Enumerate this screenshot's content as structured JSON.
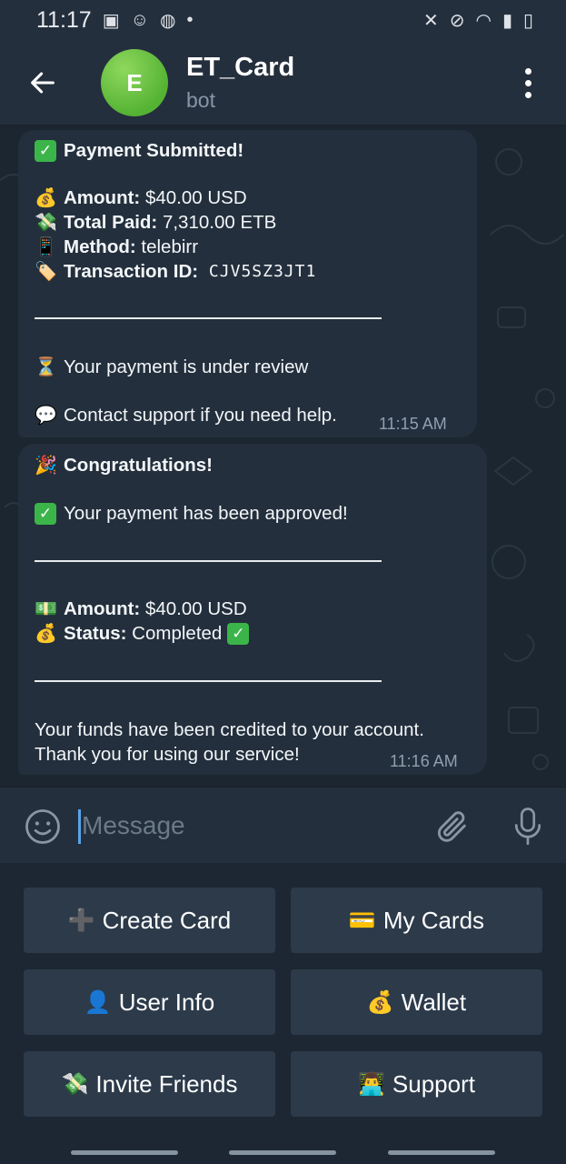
{
  "status_bar": {
    "time": "11:17"
  },
  "header": {
    "avatar_letter": "E",
    "title": "ET_Card",
    "subtitle": "bot"
  },
  "messages": [
    {
      "lines": [
        {
          "emoji": "✅",
          "bold": "Payment Submitted!",
          "text": ""
        },
        {
          "emoji": "💰",
          "bold": "Amount:",
          "text": " $40.00 USD"
        },
        {
          "emoji": "💸",
          "bold": "Total Paid:",
          "text": " 7,310.00 ETB"
        },
        {
          "emoji": "📱",
          "bold": "Method:",
          "text": " telebirr"
        },
        {
          "emoji": "🏷️",
          "bold": "Transaction ID:",
          "text": " CJV5SZ3JT1"
        },
        {
          "emoji": "⏳",
          "bold": "",
          "text": "Your payment is under review"
        },
        {
          "emoji": "💬",
          "bold": "",
          "text": "Contact support if you need help."
        }
      ],
      "time": "11:15 AM"
    },
    {
      "lines": [
        {
          "emoji": "🎉",
          "bold": "Congratulations!",
          "text": ""
        },
        {
          "emoji": "✅",
          "bold": "",
          "text": "Your payment has been approved!"
        },
        {
          "emoji": "💵",
          "bold": "Amount:",
          "text": " $40.00 USD"
        },
        {
          "emoji": "💰",
          "bold": "Status:",
          "text": " Completed"
        },
        {
          "emoji": "",
          "bold": "",
          "text": "Your funds have been credited to your account."
        },
        {
          "emoji": "",
          "bold": "",
          "text": "Thank you for using our service!"
        }
      ],
      "time": "11:16 AM"
    }
  ],
  "composer": {
    "placeholder": "Message"
  },
  "keyboard": [
    {
      "emoji": "➕",
      "label": "Create Card"
    },
    {
      "emoji": "💳",
      "label": "My Cards"
    },
    {
      "emoji": "👤",
      "label": "User Info"
    },
    {
      "emoji": "💰",
      "label": "Wallet"
    },
    {
      "emoji": "💸",
      "label": "Invite Friends"
    },
    {
      "emoji": "👨‍💻",
      "label": "Support"
    }
  ],
  "icons": {
    "back": "arrow-left-icon",
    "menu": "more-vertical-icon",
    "emoji": "smiley-icon",
    "attach": "paperclip-icon",
    "mic": "microphone-icon"
  },
  "colors": {
    "header_bg": "#242f3d",
    "chat_bg": "#1c2630",
    "bubble_bg": "#232f3c",
    "button_bg": "#2c3a4a",
    "avatar_green": "#55b333",
    "accent_blue": "#5aa4e8"
  }
}
